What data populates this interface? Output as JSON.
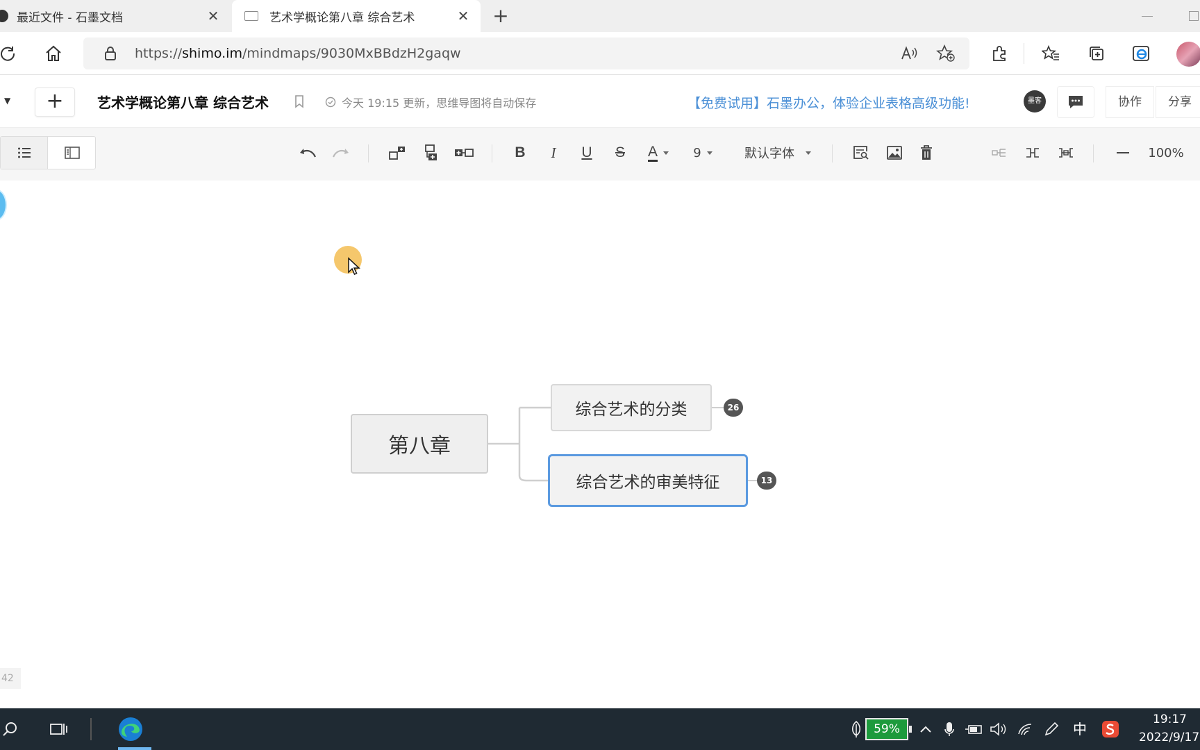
{
  "browser": {
    "tabs": [
      {
        "label": "最近文件 - 石墨文档",
        "active": false
      },
      {
        "label": "艺术学概论第八章 综合艺术",
        "active": true
      }
    ],
    "url_prefix": "https://",
    "url_host": "shimo.im",
    "url_path": "/mindmaps/9030MxBBdzH2gaqw",
    "icons": [
      "reload-icon",
      "home-icon",
      "lock-icon",
      "read-aloud-icon",
      "add-favorite-icon",
      "extensions-icon",
      "favorites-icon",
      "collections-icon",
      "ie-mode-icon",
      "profile-avatar"
    ]
  },
  "header": {
    "title": "艺术学概论第八章 综合艺术",
    "save_status": "今天 19:15 更新，思维导图将自动保存",
    "promo": "【免费试用】石墨办公，体验企业表格高级功能!",
    "avatar_text": "墨客",
    "collaborate_label": "协作",
    "share_label": "分享"
  },
  "toolbar": {
    "font_size": "9",
    "font_family": "默认字体",
    "zoom": "100%"
  },
  "mindmap": {
    "root": "第八章",
    "children": [
      {
        "label": "综合艺术的分类",
        "count": "26",
        "selected": false
      },
      {
        "label": "综合艺术的审美特征",
        "count": "13",
        "selected": true
      }
    ]
  },
  "canvas": {
    "page_indicator": "42"
  },
  "taskbar": {
    "battery": "59%",
    "ime": "中",
    "time": "19:17",
    "date": "2022/9/17"
  },
  "colors": {
    "accent_blue": "#5b9ae0",
    "promo_blue": "#4a8fd6",
    "cursor_highlight": "#f4c15c",
    "taskbar_bg": "#1f2a33",
    "battery_green": "#1c9a3c"
  }
}
